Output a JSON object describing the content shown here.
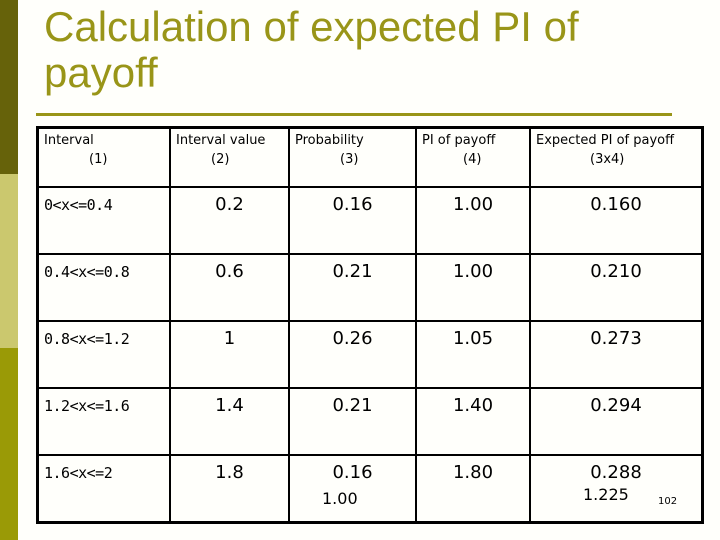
{
  "slide": {
    "title": "Calculation of expected PI of payoff",
    "page_number": "102",
    "colors": {
      "title": "#999518",
      "band_dark": "#66620a",
      "band_light": "#cbc86e",
      "band_mid": "#9a9a06"
    }
  },
  "table": {
    "headers": [
      {
        "label": "Interval",
        "num": "(1)"
      },
      {
        "label": "Interval value",
        "num": "(2)"
      },
      {
        "label": "Probability",
        "num": "(3)"
      },
      {
        "label": "PI of payoff",
        "num": "(4)"
      },
      {
        "label": "Expected PI of payoff",
        "num": "(3x4)"
      }
    ],
    "rows": [
      [
        "0<x<=0.4",
        "0.2",
        "0.16",
        "1.00",
        "0.160"
      ],
      [
        "0.4<x<=0.8",
        "0.6",
        "0.21",
        "1.00",
        "0.210"
      ],
      [
        "0.8<x<=1.2",
        "1",
        "0.26",
        "1.05",
        "0.273"
      ],
      [
        "1.2<x<=1.6",
        "1.4",
        "0.21",
        "1.40",
        "0.294"
      ],
      [
        "1.6<x<=2",
        "1.8",
        "0.16",
        "1.80",
        "0.288"
      ]
    ],
    "totals": {
      "probability": "1.00",
      "expected_pi": "1.225"
    }
  }
}
